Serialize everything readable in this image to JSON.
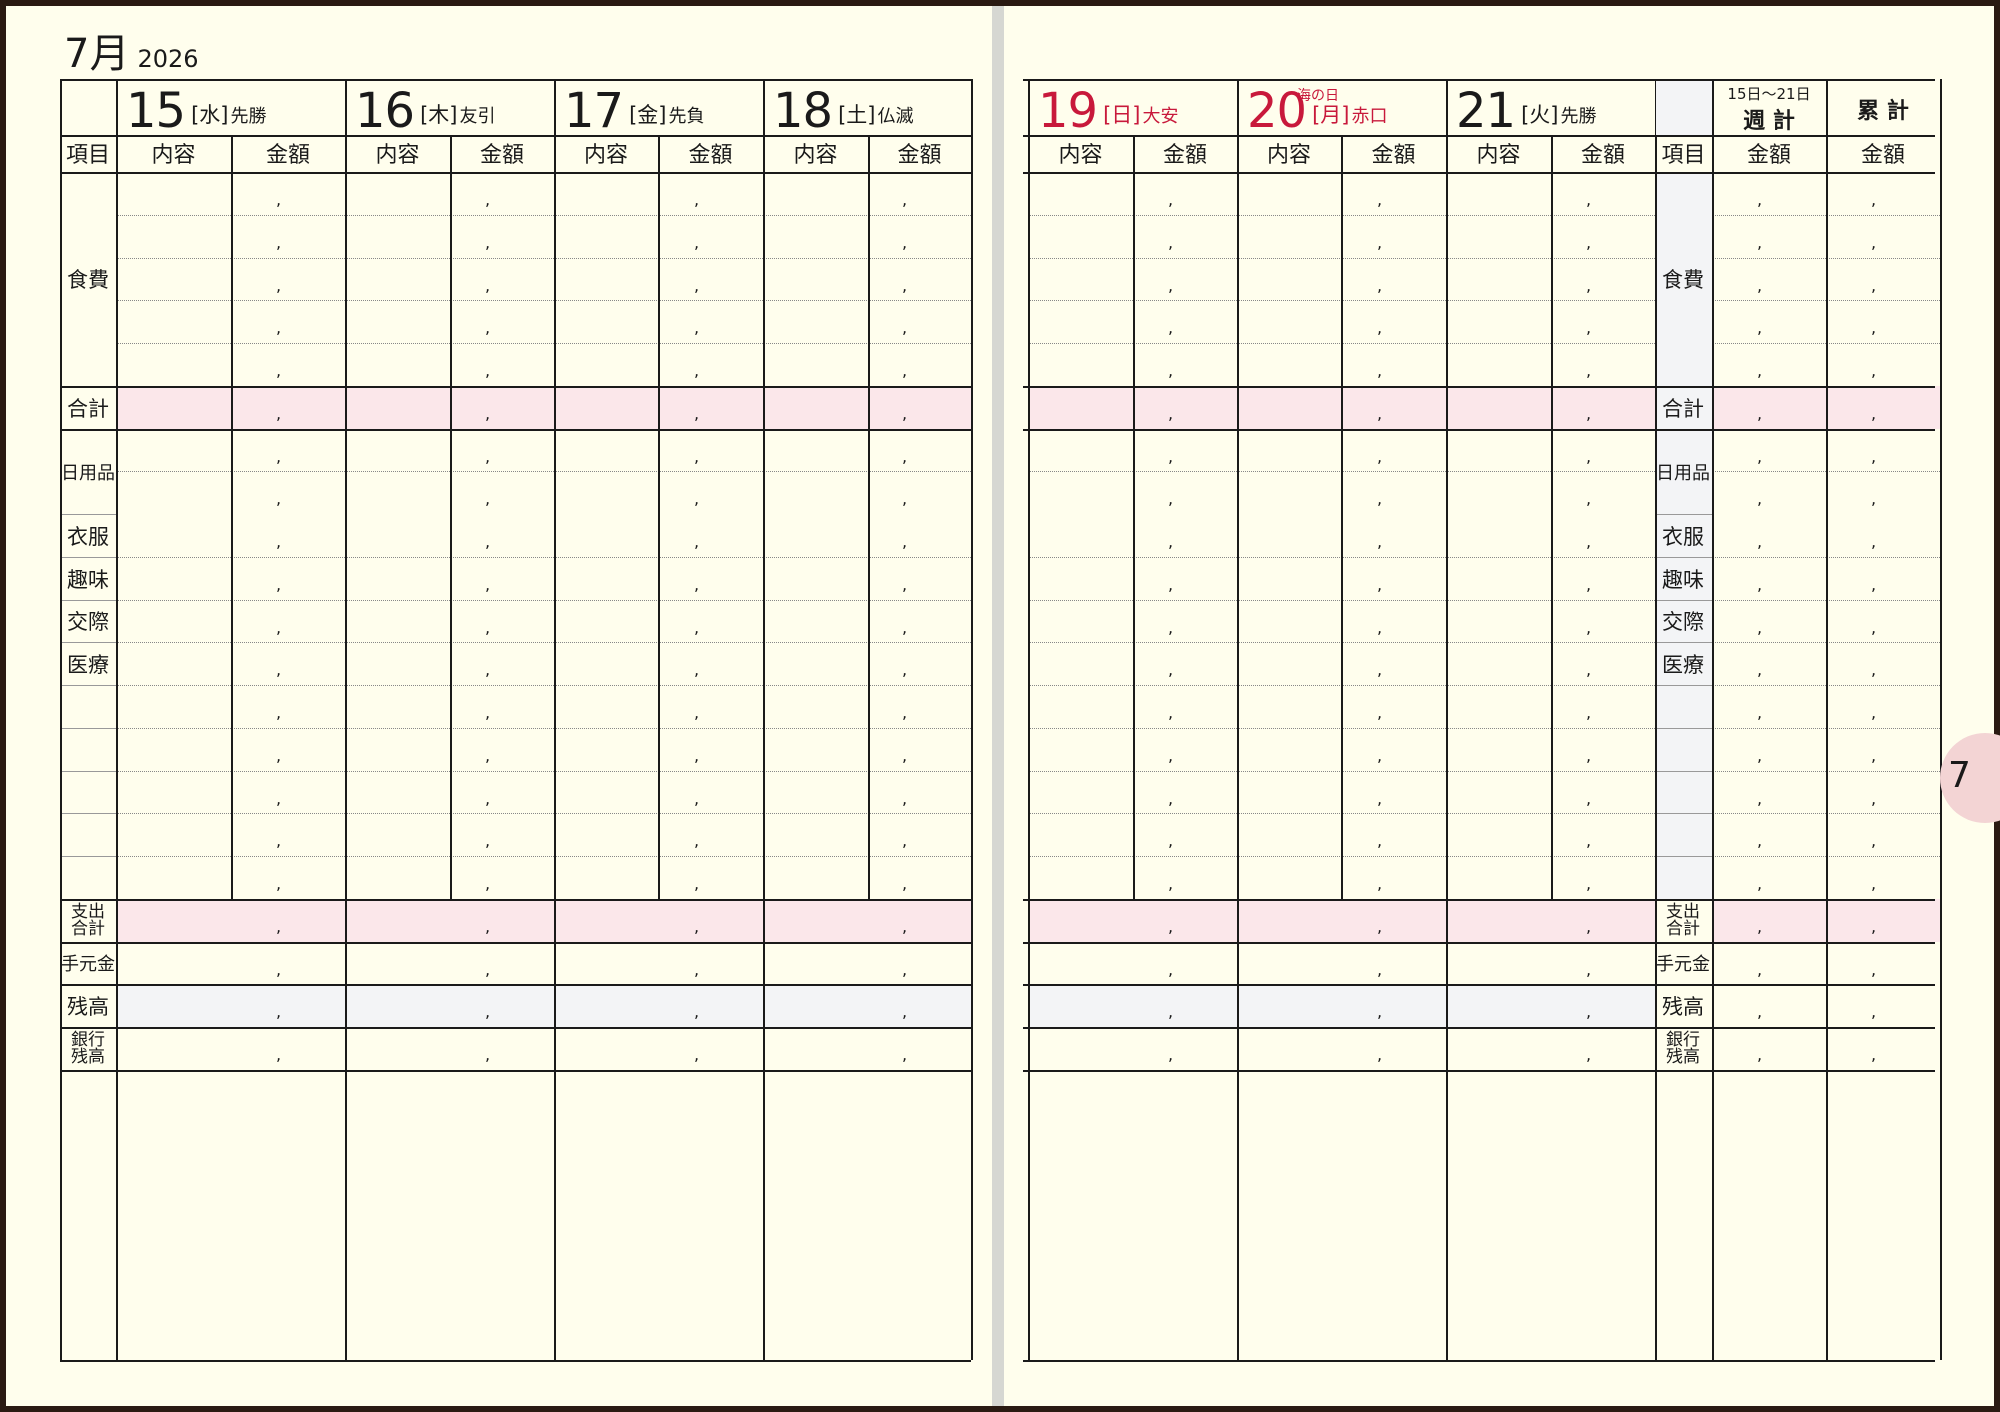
{
  "header": {
    "month": "7月",
    "year": "2026"
  },
  "left_days": [
    {
      "num": "15",
      "dow": "[水]",
      "rokuyo": "先勝"
    },
    {
      "num": "16",
      "dow": "[木]",
      "rokuyo": "友引"
    },
    {
      "num": "17",
      "dow": "[金]",
      "rokuyo": "先負"
    },
    {
      "num": "18",
      "dow": "[土]",
      "rokuyo": "仏滅"
    }
  ],
  "right_days": [
    {
      "num": "19",
      "dow": "[日]",
      "rokuyo": "大安",
      "holiday": "",
      "red": true
    },
    {
      "num": "20",
      "dow": "[月]",
      "rokuyo": "赤口",
      "holiday": "海の日",
      "red": true
    },
    {
      "num": "21",
      "dow": "[火]",
      "rokuyo": "先勝",
      "holiday": "",
      "red": false
    }
  ],
  "columns": {
    "item": "項目",
    "content": "内容",
    "amount": "金額"
  },
  "categories": {
    "food": "食費",
    "total": "合計",
    "daily_goods": "日用品",
    "clothing": "衣服",
    "hobby": "趣味",
    "social": "交際",
    "medical": "医療",
    "expense_total": "支出\n合計",
    "cash_on_hand": "手元金",
    "balance": "残高",
    "bank_balance": "銀行\n残高"
  },
  "weekly": {
    "range": "15日〜21日",
    "weekly_total": "週 計",
    "cumulative": "累 計"
  },
  "tab_label": "7",
  "comma": ","
}
